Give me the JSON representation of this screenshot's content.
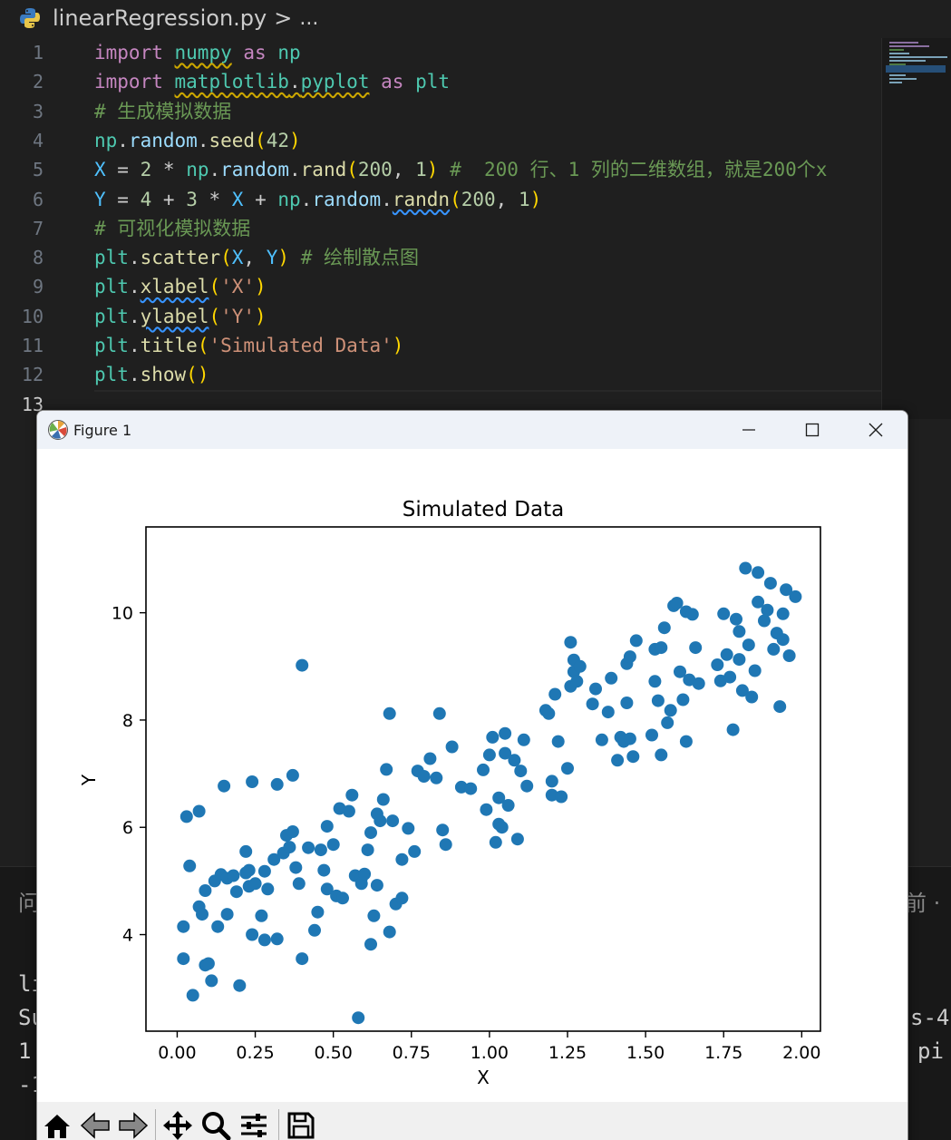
{
  "breadcrumb": {
    "file": "linearRegression.py",
    "separator": ">",
    "more": "..."
  },
  "editor": {
    "lines": [
      {
        "n": "1",
        "tokens": [
          [
            "import",
            "kw"
          ],
          [
            " ",
            ""
          ],
          [
            "numpy",
            "mod warn"
          ],
          [
            " ",
            ""
          ],
          [
            "as",
            "kw"
          ],
          [
            " ",
            ""
          ],
          [
            "np",
            "mod"
          ]
        ]
      },
      {
        "n": "2",
        "tokens": [
          [
            "import",
            "kw"
          ],
          [
            " ",
            ""
          ],
          [
            "matplotlib",
            "mod warn"
          ],
          [
            ".",
            "warn"
          ],
          [
            "pyplot",
            "mod warn"
          ],
          [
            " ",
            ""
          ],
          [
            "as",
            "kw"
          ],
          [
            " ",
            ""
          ],
          [
            "plt",
            "mod"
          ]
        ]
      },
      {
        "n": "3",
        "tokens": [
          [
            "# 生成模拟数据",
            "cmt"
          ]
        ]
      },
      {
        "n": "4",
        "tokens": [
          [
            "np",
            "mod"
          ],
          [
            ".",
            ""
          ],
          [
            "random",
            "var"
          ],
          [
            ".",
            ""
          ],
          [
            "seed",
            "fn"
          ],
          [
            "(",
            "p1"
          ],
          [
            "42",
            "num"
          ],
          [
            ")",
            "p1"
          ]
        ]
      },
      {
        "n": "5",
        "tokens": [
          [
            "X",
            "const"
          ],
          [
            " = ",
            ""
          ],
          [
            "2",
            "num"
          ],
          [
            " * ",
            ""
          ],
          [
            "np",
            "mod"
          ],
          [
            ".",
            ""
          ],
          [
            "random",
            "var"
          ],
          [
            ".",
            ""
          ],
          [
            "rand",
            "fn"
          ],
          [
            "(",
            "p1"
          ],
          [
            "200",
            "num"
          ],
          [
            ", ",
            ""
          ],
          [
            "1",
            "num"
          ],
          [
            ")",
            "p1"
          ],
          [
            " ",
            ""
          ],
          [
            "#  200 行、1 列的二维数组，就是200个x",
            "cmt"
          ]
        ]
      },
      {
        "n": "6",
        "tokens": [
          [
            "Y",
            "const"
          ],
          [
            " = ",
            ""
          ],
          [
            "4",
            "num"
          ],
          [
            " + ",
            ""
          ],
          [
            "3",
            "num"
          ],
          [
            " * ",
            ""
          ],
          [
            "X",
            "const"
          ],
          [
            " + ",
            ""
          ],
          [
            "np",
            "mod"
          ],
          [
            ".",
            ""
          ],
          [
            "random",
            "var"
          ],
          [
            ".",
            ""
          ],
          [
            "randn",
            "fn err"
          ],
          [
            "(",
            "p1"
          ],
          [
            "200",
            "num"
          ],
          [
            ", ",
            ""
          ],
          [
            "1",
            "num"
          ],
          [
            ")",
            "p1"
          ]
        ]
      },
      {
        "n": "7",
        "tokens": [
          [
            "# 可视化模拟数据",
            "cmt"
          ]
        ]
      },
      {
        "n": "8",
        "tokens": [
          [
            "plt",
            "mod"
          ],
          [
            ".",
            ""
          ],
          [
            "scatter",
            "fn"
          ],
          [
            "(",
            "p1"
          ],
          [
            "X",
            "const"
          ],
          [
            ", ",
            ""
          ],
          [
            "Y",
            "const"
          ],
          [
            ")",
            "p1"
          ],
          [
            " ",
            ""
          ],
          [
            "# 绘制散点图",
            "cmt"
          ]
        ]
      },
      {
        "n": "9",
        "tokens": [
          [
            "plt",
            "mod"
          ],
          [
            ".",
            ""
          ],
          [
            "xlabel",
            "fn err"
          ],
          [
            "(",
            "p1"
          ],
          [
            "'X'",
            "str"
          ],
          [
            ")",
            "p1"
          ]
        ]
      },
      {
        "n": "10",
        "tokens": [
          [
            "plt",
            "mod"
          ],
          [
            ".",
            ""
          ],
          [
            "ylabel",
            "fn err"
          ],
          [
            "(",
            "p1"
          ],
          [
            "'Y'",
            "str"
          ],
          [
            ")",
            "p1"
          ]
        ]
      },
      {
        "n": "11",
        "tokens": [
          [
            "plt",
            "mod"
          ],
          [
            ".",
            ""
          ],
          [
            "title",
            "fn"
          ],
          [
            "(",
            "p1"
          ],
          [
            "'Simulated Data'",
            "str"
          ],
          [
            ")",
            "p1"
          ]
        ]
      },
      {
        "n": "12",
        "tokens": [
          [
            "plt",
            "mod"
          ],
          [
            ".",
            ""
          ],
          [
            "show",
            "fn"
          ],
          [
            "(",
            "p1"
          ],
          [
            ")",
            "p1"
          ]
        ]
      },
      {
        "n": "13",
        "tokens": []
      }
    ]
  },
  "terminal": {
    "left_tab_fragment": "问",
    "right_tab_fragment": "前 ·",
    "left_fragments": [
      "li",
      "Su",
      "1",
      "-1"
    ],
    "right_fragments": [
      "s-4",
      "pi"
    ]
  },
  "figure_window": {
    "title": "Figure 1",
    "toolbar_buttons": [
      "home-icon",
      "back-icon",
      "forward-icon",
      "pan-icon",
      "zoom-icon",
      "configure-subplots-icon",
      "save-icon"
    ]
  },
  "colors": {
    "accent_marker": "#1f77b4",
    "editor_bg": "#1f1f1f"
  },
  "chart_data": {
    "type": "scatter",
    "title": "Simulated Data",
    "xlabel": "X",
    "ylabel": "Y",
    "xlim": [
      -0.1,
      2.06
    ],
    "ylim": [
      2.2,
      11.6
    ],
    "xticks": [
      "0.00",
      "0.25",
      "0.50",
      "0.75",
      "1.00",
      "1.25",
      "1.50",
      "1.75",
      "2.00"
    ],
    "yticks": [
      "4",
      "6",
      "8",
      "10"
    ],
    "grid": false,
    "color": "#1f77b4",
    "x": [
      0.02,
      0.02,
      0.03,
      0.04,
      0.05,
      0.07,
      0.07,
      0.08,
      0.09,
      0.09,
      0.1,
      0.11,
      0.12,
      0.13,
      0.14,
      0.15,
      0.16,
      0.16,
      0.18,
      0.19,
      0.2,
      0.22,
      0.22,
      0.23,
      0.23,
      0.24,
      0.24,
      0.25,
      0.27,
      0.28,
      0.28,
      0.29,
      0.31,
      0.32,
      0.32,
      0.34,
      0.35,
      0.36,
      0.37,
      0.37,
      0.38,
      0.39,
      0.4,
      0.4,
      0.42,
      0.44,
      0.45,
      0.46,
      0.47,
      0.48,
      0.48,
      0.5,
      0.51,
      0.52,
      0.53,
      0.55,
      0.56,
      0.57,
      0.58,
      0.59,
      0.59,
      0.6,
      0.61,
      0.62,
      0.62,
      0.63,
      0.64,
      0.64,
      0.65,
      0.66,
      0.67,
      0.68,
      0.68,
      0.69,
      0.7,
      0.72,
      0.72,
      0.74,
      0.76,
      0.77,
      0.79,
      0.81,
      0.83,
      0.84,
      0.85,
      0.86,
      0.88,
      0.91,
      0.94,
      0.98,
      0.99,
      1.0,
      1.01,
      1.02,
      1.03,
      1.03,
      1.04,
      1.05,
      1.05,
      1.06,
      1.08,
      1.09,
      1.1,
      1.11,
      1.12,
      1.18,
      1.19,
      1.2,
      1.2,
      1.21,
      1.22,
      1.23,
      1.25,
      1.26,
      1.26,
      1.27,
      1.27,
      1.28,
      1.29,
      1.33,
      1.34,
      1.36,
      1.38,
      1.39,
      1.41,
      1.42,
      1.43,
      1.44,
      1.44,
      1.45,
      1.45,
      1.46,
      1.47,
      1.52,
      1.53,
      1.53,
      1.54,
      1.55,
      1.55,
      1.56,
      1.57,
      1.58,
      1.59,
      1.6,
      1.61,
      1.62,
      1.63,
      1.63,
      1.64,
      1.65,
      1.66,
      1.67,
      1.73,
      1.74,
      1.75,
      1.76,
      1.77,
      1.78,
      1.79,
      1.8,
      1.8,
      1.81,
      1.82,
      1.83,
      1.84,
      1.85,
      1.86,
      1.86,
      1.88,
      1.89,
      1.9,
      1.91,
      1.92,
      1.93,
      1.94,
      1.94,
      1.95,
      1.96,
      1.98
    ],
    "y": [
      3.55,
      4.15,
      6.2,
      5.28,
      2.87,
      6.3,
      4.52,
      4.38,
      3.43,
      4.82,
      3.46,
      3.14,
      5,
      4.15,
      5.12,
      6.77,
      4.38,
      5.05,
      5.1,
      4.8,
      3.05,
      5.55,
      5.15,
      4.9,
      5.2,
      4,
      6.85,
      4.95,
      4.35,
      3.9,
      5.18,
      4.85,
      5.4,
      6.8,
      3.92,
      5.52,
      5.85,
      5.63,
      5.92,
      6.97,
      5.25,
      4.95,
      3.55,
      9.02,
      5.62,
      4.08,
      4.42,
      5.58,
      5.2,
      6.02,
      4.85,
      5.68,
      4.72,
      6.35,
      4.68,
      6.3,
      6.6,
      5.1,
      2.45,
      5.05,
      4.95,
      5.13,
      5.58,
      3.82,
      5.9,
      4.35,
      4.92,
      6.25,
      6.12,
      6.52,
      7.08,
      8.12,
      4.05,
      6.12,
      4.57,
      4.68,
      5.4,
      5.98,
      5.55,
      7.05,
      6.95,
      7.28,
      6.92,
      8.12,
      5.95,
      5.68,
      7.5,
      6.75,
      6.72,
      7.07,
      6.33,
      7.35,
      7.68,
      5.72,
      6.55,
      6.06,
      6.0,
      7.75,
      7.38,
      6.41,
      7.25,
      5.78,
      7.05,
      7.63,
      6.77,
      8.18,
      8.12,
      6.86,
      6.6,
      8.48,
      7.6,
      6.57,
      7.1,
      8.63,
      9.45,
      9.12,
      8.9,
      8.72,
      9.0,
      8.3,
      8.58,
      7.63,
      8.15,
      8.78,
      7.25,
      7.68,
      7.6,
      9.05,
      8.32,
      9.18,
      7.65,
      7.32,
      9.48,
      7.72,
      8.72,
      9.32,
      8.36,
      7.35,
      9.35,
      9.72,
      7.95,
      8.18,
      10.13,
      10.18,
      8.9,
      8.38,
      10.02,
      7.6,
      8.75,
      9.97,
      9.35,
      8.68,
      9.03,
      8.73,
      9.98,
      9.22,
      8.8,
      7.82,
      9.88,
      9.13,
      9.65,
      8.55,
      10.83,
      9.4,
      8.43,
      8.92,
      10.2,
      10.75,
      9.85,
      10.05,
      10.55,
      9.32,
      9.62,
      8.25,
      9.5,
      9.98,
      10.43,
      9.2,
      10.3,
      8.98,
      10.92,
      9.35,
      8.08,
      11.18
    ]
  }
}
